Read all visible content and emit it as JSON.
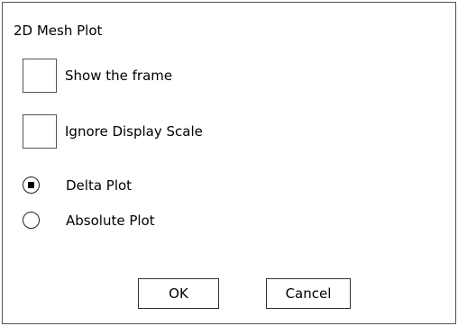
{
  "dialog": {
    "title": "2D Mesh Plot",
    "checkboxes": [
      {
        "label": "Show the frame",
        "checked": false
      },
      {
        "label": "Ignore Display Scale",
        "checked": false
      }
    ],
    "plot_mode": {
      "options": [
        {
          "label": "Delta Plot",
          "selected": true
        },
        {
          "label": "Absolute Plot",
          "selected": false
        }
      ]
    },
    "buttons": {
      "ok_label": "OK",
      "cancel_label": "Cancel"
    }
  }
}
